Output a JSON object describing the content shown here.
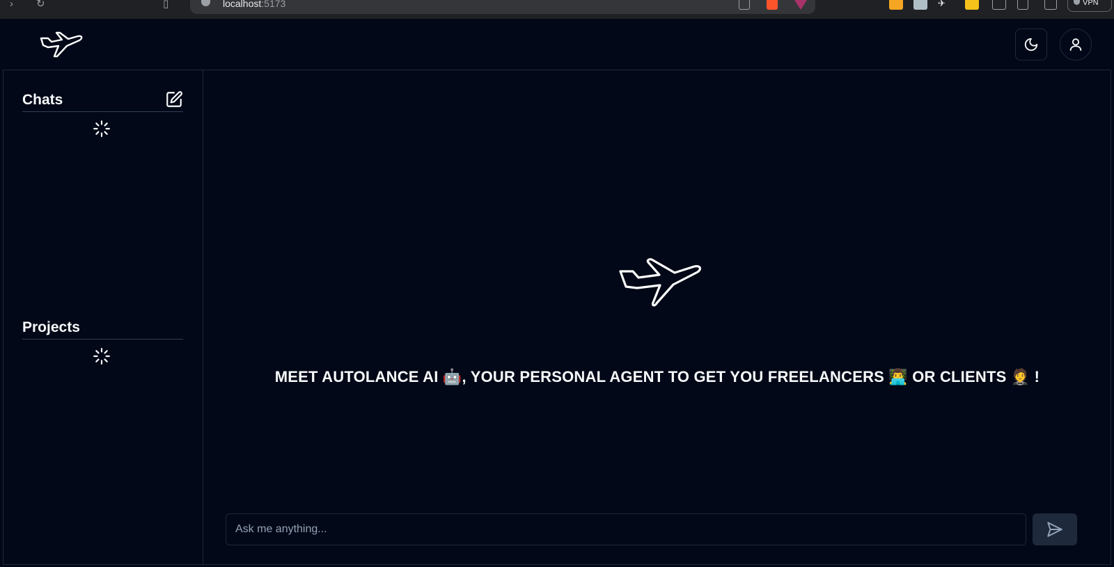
{
  "browser": {
    "url_host": "localhost",
    "url_port": ":5173",
    "vpn_label": "VPN"
  },
  "header": {
    "logo_icon": "airplane-icon",
    "theme_toggle_icon": "moon-icon",
    "user_icon": "user-icon"
  },
  "sidebar": {
    "chats": {
      "title": "Chats",
      "new_chat_icon": "edit-icon",
      "loading_icon": "spinner-icon"
    },
    "projects": {
      "title": "Projects",
      "loading_icon": "spinner-icon"
    }
  },
  "main": {
    "hero_icon": "airplane-icon",
    "hero_text": "MEET AUTOLANCE AI 🤖, YOUR PERSONAL AGENT TO GET YOU FREELANCERS 👨‍💻 OR CLIENTS 🤵 !",
    "input_placeholder": "Ask me anything...",
    "send_icon": "send-icon"
  },
  "colors": {
    "background": "#020817",
    "border": "#1e293b",
    "text": "#f8fafc",
    "muted_text": "#94a3b8"
  }
}
